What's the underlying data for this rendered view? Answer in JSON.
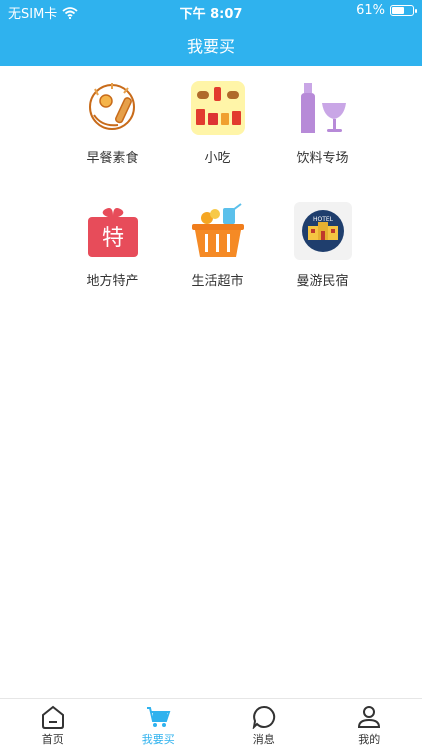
{
  "status_bar": {
    "carrier": "无SIM卡",
    "time": "下午 8:07",
    "battery_text": "61%",
    "battery_level": 0.61
  },
  "header": {
    "title": "我要买"
  },
  "categories": [
    {
      "label": "早餐素食",
      "icon": "breakfast-icon"
    },
    {
      "label": "小吃",
      "icon": "snacks-icon"
    },
    {
      "label": "饮料专场",
      "icon": "drinks-icon"
    },
    {
      "label": "地方特产",
      "icon": "local-specialty-gift-icon"
    },
    {
      "label": "生活超市",
      "icon": "supermarket-basket-icon"
    },
    {
      "label": "曼游民宿",
      "icon": "hotel-icon"
    }
  ],
  "hotel_sign": "HOTEL",
  "gift_char": "特",
  "tabbar": {
    "items": [
      {
        "label": "首页",
        "icon": "home-icon",
        "active": false
      },
      {
        "label": "我要买",
        "icon": "cart-icon",
        "active": true
      },
      {
        "label": "消息",
        "icon": "message-icon",
        "active": false
      },
      {
        "label": "我的",
        "icon": "profile-icon",
        "active": false
      }
    ]
  },
  "colors": {
    "primary": "#2fb2ee",
    "text": "#333333"
  }
}
